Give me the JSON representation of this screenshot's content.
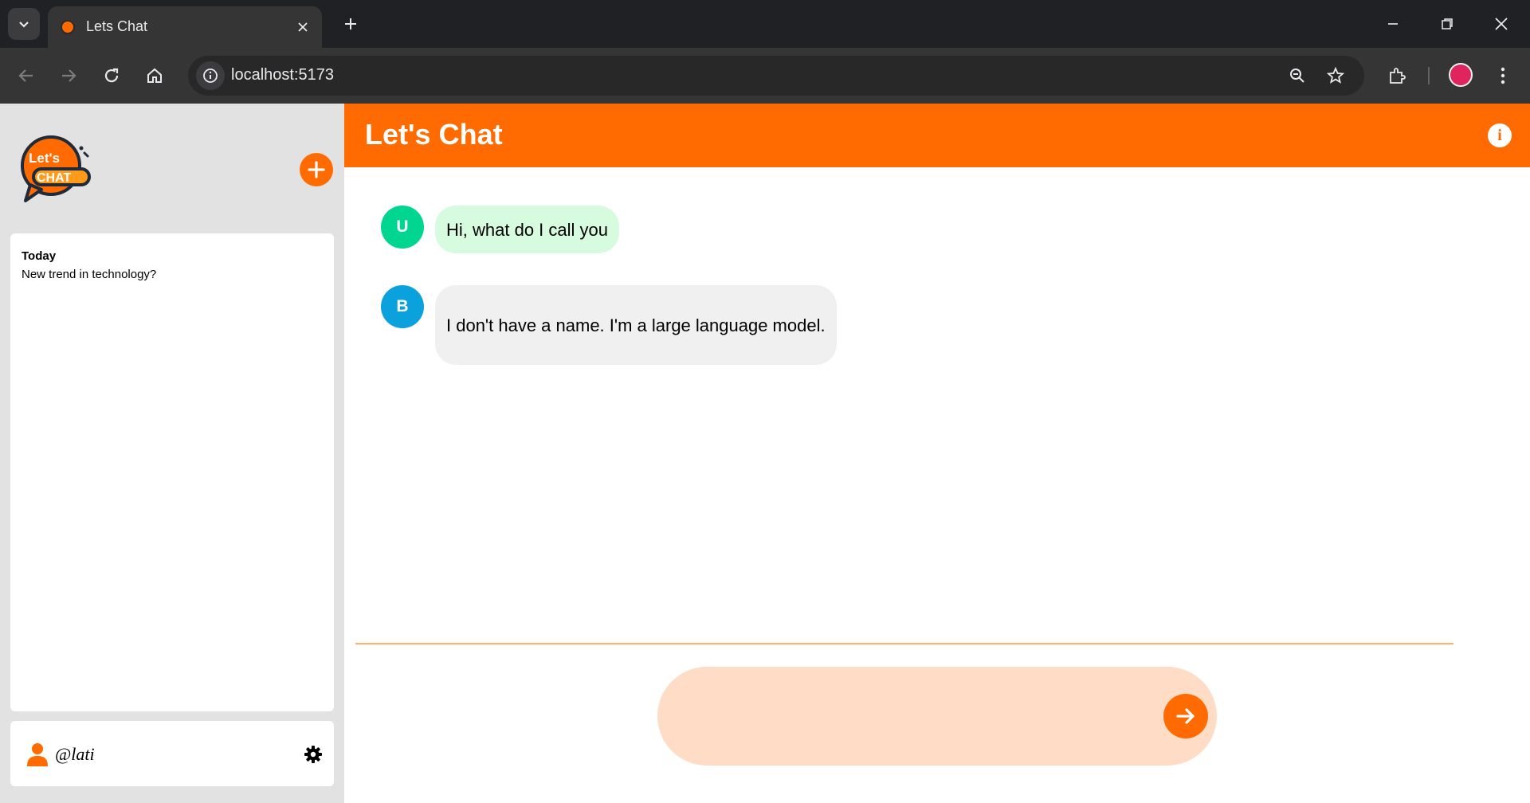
{
  "browser": {
    "tab_title": "Lets Chat",
    "url": "localhost:5173"
  },
  "app": {
    "header_title": "Let's Chat",
    "brand_color": "#ff6b00",
    "logo": {
      "line1": "Let's",
      "line2": "CHAT"
    },
    "info_icon_glyph": "i"
  },
  "sidebar": {
    "history_sections": [
      {
        "label": "Today",
        "items": [
          "New trend in technology?"
        ]
      }
    ],
    "user": {
      "handle": "@lati"
    }
  },
  "messages": [
    {
      "role": "user",
      "avatar_letter": "U",
      "avatar_color": "#00d68f",
      "text": "Hi, what do I call you"
    },
    {
      "role": "bot",
      "avatar_letter": "B",
      "avatar_color": "#0aa1dd",
      "text": "I don't have a name. I'm a large language model."
    }
  ],
  "composer": {
    "value": "",
    "placeholder": ""
  },
  "icons": {
    "tab_search": "chevron-down-icon",
    "tab_close": "close-icon",
    "new_tab": "plus-icon",
    "back": "arrow-left-icon",
    "forward": "arrow-right-icon",
    "reload": "reload-icon",
    "home": "home-icon",
    "zoom": "zoom-out-icon",
    "bookmark": "star-icon",
    "extensions": "puzzle-icon",
    "menu": "kebab-menu-icon",
    "new_chat": "plus-icon",
    "user": "person-icon",
    "settings": "gear-icon",
    "send": "arrow-right-icon",
    "info": "info-icon"
  }
}
